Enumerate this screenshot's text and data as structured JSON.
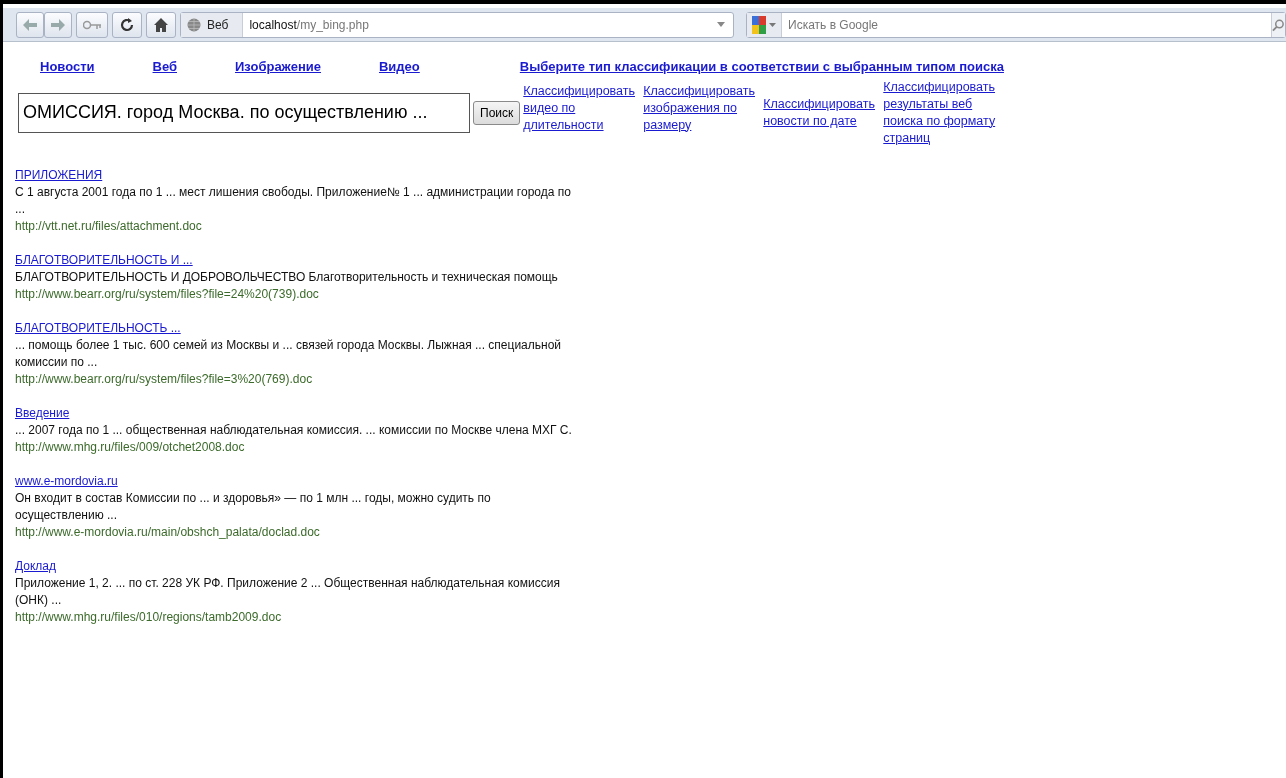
{
  "browser": {
    "site_label": "Веб",
    "url_host": "localhost",
    "url_path": "/my_bing.php",
    "search_placeholder": "Искать в Google"
  },
  "nav_links": [
    "Новости",
    "Веб",
    "Изображение",
    "Видео"
  ],
  "classification_heading": "Выберите тип классификации в соответствии с выбранным типом поиска",
  "query": "ОМИССИЯ. город Москва. по осуществлению ...",
  "search_button": "Поиск",
  "classify_links": [
    "Классифицировать видео по длительности",
    "Классифицировать изображения по размеру",
    "Классифицировать новости по дате",
    "Классифицировать результаты веб поиска по формату страниц"
  ],
  "results": [
    {
      "title": "ПРИЛОЖЕНИЯ",
      "snippet": "С 1 августа 2001 года по 1 ... мест лишения свободы. Приложение№ 1 ... администрации города по ...",
      "url": "http://vtt.net.ru/files/attachment.doc"
    },
    {
      "title": "БЛАГОТВОРИТЕЛЬНОСТЬ И ...",
      "snippet": "БЛАГОТВОРИТЕЛЬНОСТЬ И ДОБРОВОЛЬЧЕСТВО Благотворительность и техническая помощь",
      "url": "http://www.bearr.org/ru/system/files?file=24%20(739).doc"
    },
    {
      "title": "БЛАГОТВОРИТЕЛЬНОСТЬ ...",
      "snippet": "... помощь более 1 тыс. 600 семей из Москвы и ... связей города Москвы. Лыжная ... специальной комиссии по ...",
      "url": "http://www.bearr.org/ru/system/files?file=3%20(769).doc"
    },
    {
      "title": "Введение",
      "snippet": "... 2007 года по 1 ... общественная наблюдательная комиссия. ... комиссии по Москве члена МХГ С.",
      "url": "http://www.mhg.ru/files/009/otchet2008.doc"
    },
    {
      "title": "www.e-mordovia.ru",
      "snippet": "Он входит в состав Комиссии по ... и здоровья» — по 1 млн ... годы, можно судить по осуществлению ...",
      "url": "http://www.e-mordovia.ru/main/obshch_palata/doclad.doc"
    },
    {
      "title": "Доклад",
      "snippet": "Приложение 1, 2. ... по ст. 228 УК РФ. Приложение 2 ... Общественная наблюдательная комиссия (ОНК) ...",
      "url": "http://www.mhg.ru/files/010/regions/tamb2009.doc"
    }
  ]
}
